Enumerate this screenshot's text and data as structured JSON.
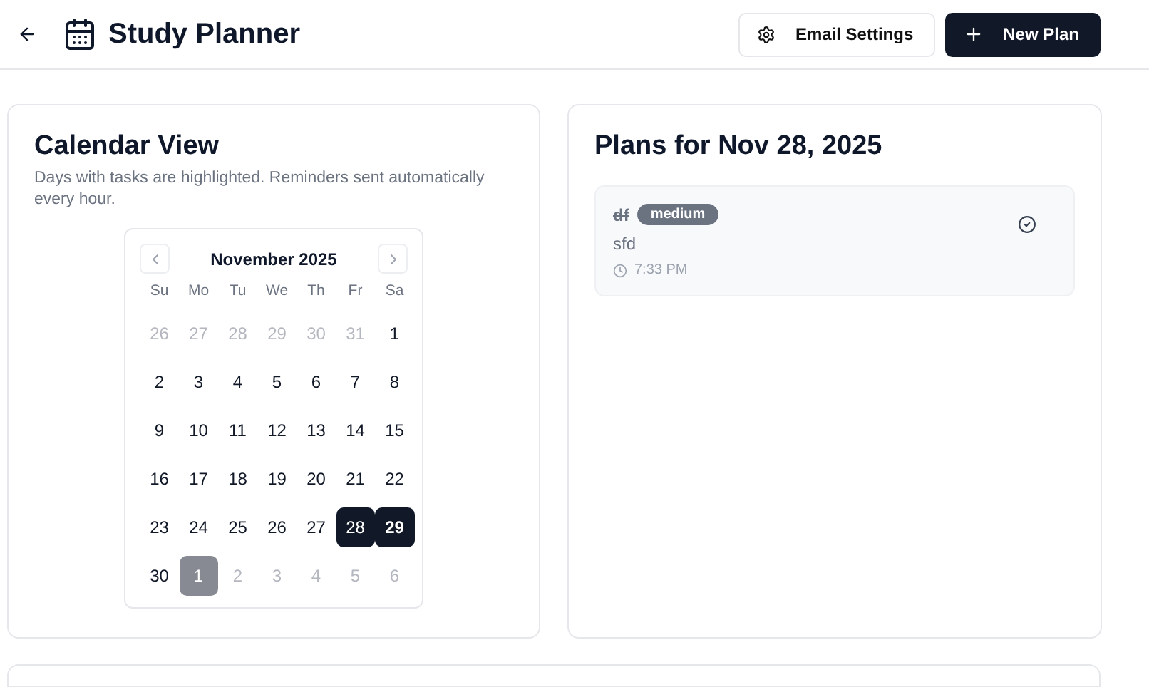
{
  "header": {
    "title": "Study Planner",
    "buttons": [
      {
        "label": "Email Settings",
        "kind": "outline"
      },
      {
        "label": "New Plan",
        "kind": "primary"
      }
    ]
  },
  "calendar": {
    "title": "Calendar View",
    "description": "Days with tasks are highlighted. Reminders sent automatically every hour.",
    "month": "November 2025",
    "weekdays": [
      "Su",
      "Mo",
      "Tu",
      "We",
      "Th",
      "Fr",
      "Sa"
    ],
    "weeks": [
      [
        {
          "day": "26",
          "outside": true,
          "today": false,
          "has_tasks": false
        },
        {
          "day": "27",
          "outside": true,
          "today": false,
          "has_tasks": false
        },
        {
          "day": "28",
          "outside": true,
          "today": false,
          "has_tasks": false
        },
        {
          "day": "29",
          "outside": true,
          "today": false,
          "has_tasks": false
        },
        {
          "day": "30",
          "outside": true,
          "today": false,
          "has_tasks": false
        },
        {
          "day": "31",
          "outside": true,
          "today": false,
          "has_tasks": false
        },
        {
          "day": "1",
          "outside": false,
          "today": false,
          "has_tasks": false
        }
      ],
      [
        {
          "day": "2",
          "outside": false,
          "today": false,
          "has_tasks": false
        },
        {
          "day": "3",
          "outside": false,
          "today": false,
          "has_tasks": false
        },
        {
          "day": "4",
          "outside": false,
          "today": false,
          "has_tasks": false
        },
        {
          "day": "5",
          "outside": false,
          "today": false,
          "has_tasks": false
        },
        {
          "day": "6",
          "outside": false,
          "today": false,
          "has_tasks": false
        },
        {
          "day": "7",
          "outside": false,
          "today": false,
          "has_tasks": false
        },
        {
          "day": "8",
          "outside": false,
          "today": false,
          "has_tasks": false
        }
      ],
      [
        {
          "day": "9",
          "outside": false,
          "today": false,
          "has_tasks": false
        },
        {
          "day": "10",
          "outside": false,
          "today": false,
          "has_tasks": false
        },
        {
          "day": "11",
          "outside": false,
          "today": false,
          "has_tasks": false
        },
        {
          "day": "12",
          "outside": false,
          "today": false,
          "has_tasks": false
        },
        {
          "day": "13",
          "outside": false,
          "today": false,
          "has_tasks": false
        },
        {
          "day": "14",
          "outside": false,
          "today": false,
          "has_tasks": false
        },
        {
          "day": "15",
          "outside": false,
          "today": false,
          "has_tasks": false
        }
      ],
      [
        {
          "day": "16",
          "outside": false,
          "today": false,
          "has_tasks": false
        },
        {
          "day": "17",
          "outside": false,
          "today": false,
          "has_tasks": false
        },
        {
          "day": "18",
          "outside": false,
          "today": false,
          "has_tasks": false
        },
        {
          "day": "19",
          "outside": false,
          "today": false,
          "has_tasks": false
        },
        {
          "day": "20",
          "outside": false,
          "today": false,
          "has_tasks": false
        },
        {
          "day": "21",
          "outside": false,
          "today": false,
          "has_tasks": false
        },
        {
          "day": "22",
          "outside": false,
          "today": false,
          "has_tasks": false
        }
      ],
      [
        {
          "day": "23",
          "outside": false,
          "today": false,
          "has_tasks": false
        },
        {
          "day": "24",
          "outside": false,
          "today": false,
          "has_tasks": false
        },
        {
          "day": "25",
          "outside": false,
          "today": false,
          "has_tasks": false
        },
        {
          "day": "26",
          "outside": false,
          "today": false,
          "has_tasks": false
        },
        {
          "day": "27",
          "outside": false,
          "today": false,
          "has_tasks": false
        },
        {
          "day": "28",
          "outside": false,
          "today": false,
          "has_tasks": true
        },
        {
          "day": "29",
          "outside": false,
          "today": true,
          "has_tasks": true
        }
      ],
      [
        {
          "day": "30",
          "outside": false,
          "today": false,
          "has_tasks": false
        },
        {
          "day": "1",
          "outside": true,
          "today": false,
          "has_tasks": true
        },
        {
          "day": "2",
          "outside": true,
          "today": false,
          "has_tasks": false
        },
        {
          "day": "3",
          "outside": true,
          "today": false,
          "has_tasks": false
        },
        {
          "day": "4",
          "outside": true,
          "today": false,
          "has_tasks": false
        },
        {
          "day": "5",
          "outside": true,
          "today": false,
          "has_tasks": false
        },
        {
          "day": "6",
          "outside": true,
          "today": false,
          "has_tasks": false
        }
      ]
    ]
  },
  "plans": {
    "title": "Plans for Nov 28, 2025",
    "items": [
      {
        "title": "df",
        "completed": true,
        "priority": "medium",
        "description": "sfd",
        "time": "7:33 PM"
      }
    ]
  }
}
